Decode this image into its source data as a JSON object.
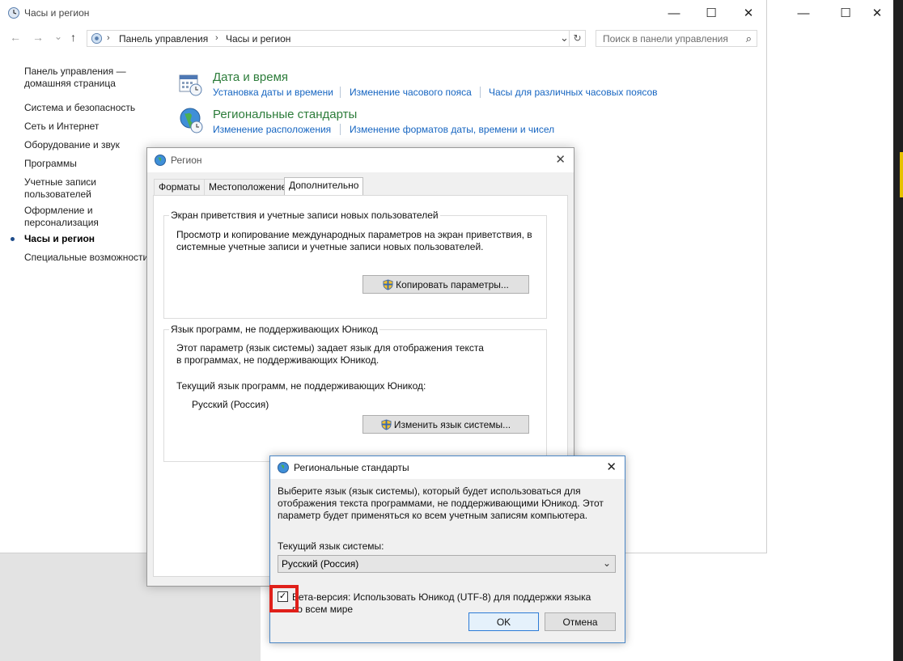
{
  "bg_window": {
    "minimize": "—",
    "maximize": "☐",
    "close": "✕"
  },
  "main_window": {
    "title": "Часы и регион",
    "caption": {
      "minimize": "—",
      "maximize": "☐",
      "close": "✕"
    },
    "nav": {
      "back": "←",
      "forward": "→",
      "recent": "⌄",
      "up": "↑"
    },
    "address": {
      "parts": [
        "Панель управления",
        "Часы и регион"
      ],
      "sep": "›",
      "dropdown": "⌄",
      "refresh": "↻"
    },
    "search": {
      "placeholder": "Поиск в панели управления",
      "icon": "⌕"
    },
    "sidebar": {
      "home": "Панель управления — домашняя страница",
      "items": [
        "Система и безопасность",
        "Сеть и Интернет",
        "Оборудование и звук",
        "Программы",
        "Учетные записи пользователей",
        "Оформление и персонализация",
        "Часы и регион",
        "Специальные возможности"
      ],
      "active": "Часы и регион"
    },
    "categories": [
      {
        "title": "Дата и время",
        "icon": "calendar-clock-icon",
        "links": [
          "Установка даты и времени",
          "Изменение часового пояса",
          "Часы для различных часовых поясов"
        ]
      },
      {
        "title": "Региональные стандарты",
        "icon": "globe-clock-icon",
        "links": [
          "Изменение расположения",
          "Изменение форматов даты, времени и чисел"
        ]
      }
    ]
  },
  "region_dialog": {
    "title": "Регион",
    "close": "✕",
    "tabs": [
      "Форматы",
      "Местоположение",
      "Дополнительно"
    ],
    "selected_tab": "Дополнительно",
    "group1": {
      "label": "Экран приветствия и учетные записи новых пользователей",
      "text": "Просмотр и копирование международных параметров на экран приветствия, в системные учетные записи и учетные записи новых пользователей.",
      "button": "Копировать параметры..."
    },
    "group2": {
      "label": "Язык программ, не поддерживающих Юникод",
      "text": "Этот параметр (язык системы) задает язык для отображения текста в программах, не поддерживающих Юникод.",
      "current_label": "Текущий язык программ, не поддерживающих Юникод:",
      "current_value": "Русский (Россия)",
      "button": "Изменить язык системы..."
    }
  },
  "sub_dialog": {
    "title": "Региональные стандарты",
    "close": "✕",
    "description": "Выберите язык (язык системы), который будет использоваться для отображения текста программами, не поддерживающими Юникод. Этот параметр будет применяться ко всем учетным записям компьютера.",
    "current_label": "Текущий язык системы:",
    "combo_value": "Русский (Россия)",
    "combo_arrow": "⌄",
    "beta_checkbox": {
      "checked": true,
      "mark": "✓",
      "label": "Бета-версия: Использовать Юникод (UTF-8) для поддержки языка во всем мире"
    },
    "ok": "OK",
    "cancel": "Отмена",
    "highlight_color": "#e0201a"
  }
}
